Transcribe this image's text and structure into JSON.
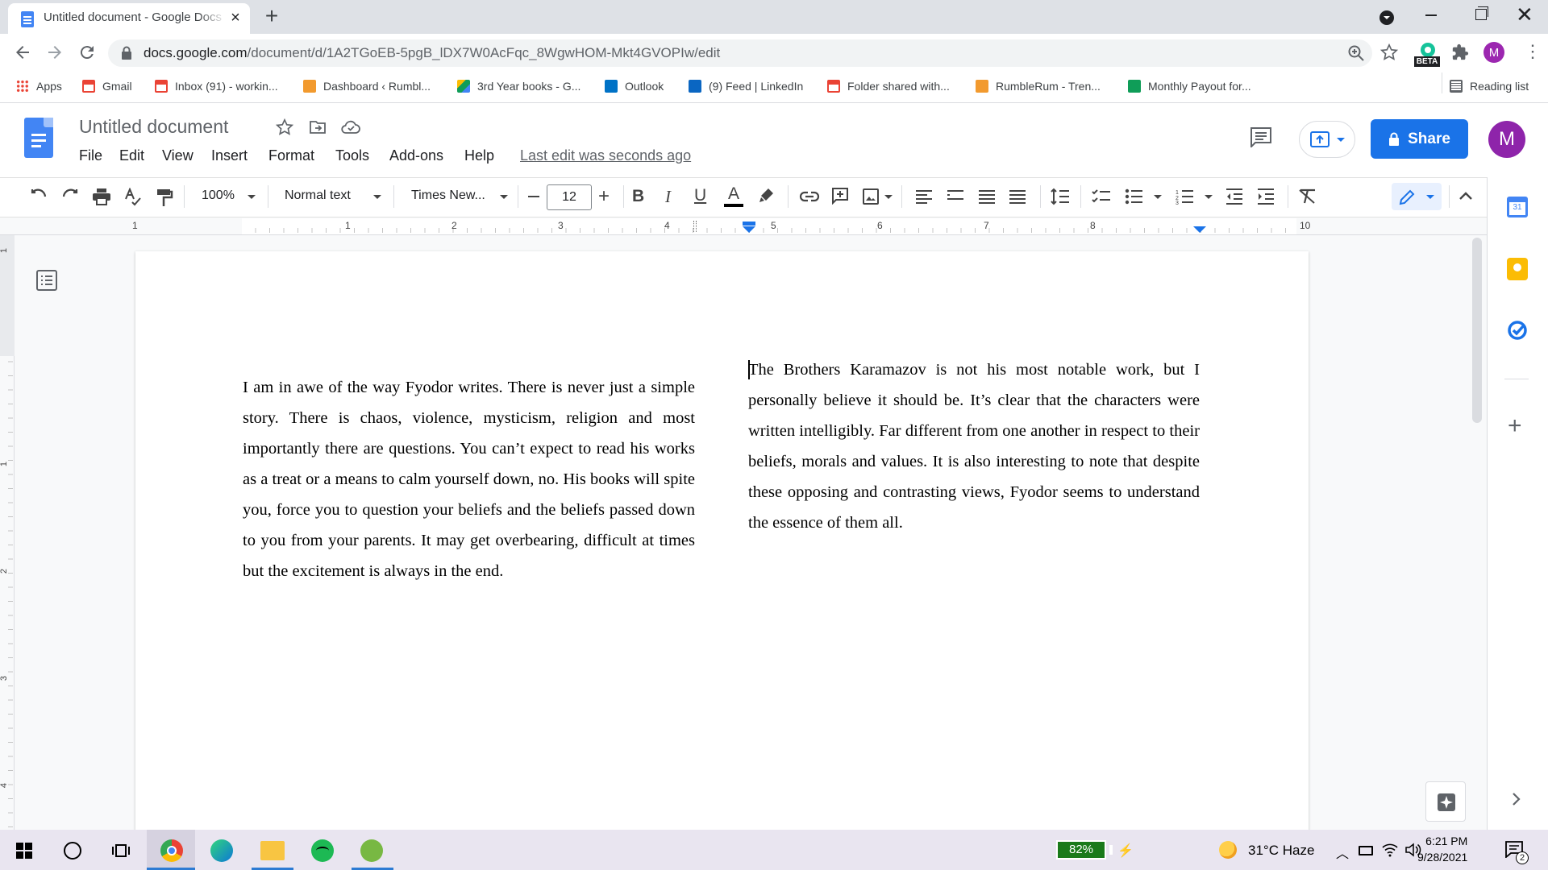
{
  "browser": {
    "tab_title": "Untitled document - Google Docs",
    "url_host": "docs.google.com",
    "url_path": "/document/d/1A2TGoEB-5pgB_lDX7W0AcFqc_8WgwHOM-Mkt4GVOPIw/edit",
    "profile_initial": "M",
    "extension_badge": "BETA",
    "reading_list": "Reading list",
    "bookmarks": [
      {
        "label": "Apps",
        "icon": "apps-grid-icon",
        "color": "#4285f4"
      },
      {
        "label": "Gmail",
        "icon": "gmail-icon",
        "color": "#ea4335"
      },
      {
        "label": "Inbox (91) - workin...",
        "icon": "gmail-icon",
        "color": "#ea4335"
      },
      {
        "label": "Dashboard ‹ Rumbl...",
        "icon": "rumblerum-icon",
        "color": "#f29a2e"
      },
      {
        "label": "3rd Year books - G...",
        "icon": "google-drive-icon",
        "color": "#0f9d58"
      },
      {
        "label": "Outlook",
        "icon": "outlook-icon",
        "color": "#0072c6"
      },
      {
        "label": "(9) Feed | LinkedIn",
        "icon": "linkedin-icon",
        "color": "#0a66c2"
      },
      {
        "label": "Folder shared with...",
        "icon": "gmail-icon",
        "color": "#ea4335"
      },
      {
        "label": "RumbleRum - Tren...",
        "icon": "rumblerum-icon",
        "color": "#f29a2e"
      },
      {
        "label": "Monthly Payout for...",
        "icon": "google-sheets-icon",
        "color": "#0f9d58"
      }
    ]
  },
  "docs": {
    "title": "Untitled document",
    "menu": [
      "File",
      "Edit",
      "View",
      "Insert",
      "Format",
      "Tools",
      "Add-ons",
      "Help"
    ],
    "last_edit": "Last edit was seconds ago",
    "share_label": "Share",
    "user_initial": "M",
    "colors": {
      "accent": "#1a73e8",
      "docs_blue": "#4285f4",
      "avatar": "#8e24aa"
    }
  },
  "toolbar": {
    "zoom": "100%",
    "style": "Normal text",
    "font": "Times New...",
    "font_size": "12"
  },
  "ruler": {
    "labels": [
      "1",
      "1",
      "2",
      "3",
      "4",
      "5",
      "6",
      "7",
      "8",
      "10"
    ],
    "vertical_labels": [
      "1",
      "1",
      "2",
      "3",
      "4"
    ]
  },
  "document": {
    "left_column": "I am in awe of the way Fyodor writes. There is never just a simple story. There is chaos, violence, mysticism, religion and most importantly there are questions. You can’t expect to read his works as a treat or a means to calm yourself down, no. His books will spite you, force you to question your beliefs and the beliefs passed down to you from your parents. It may get overbearing, difficult at times but the excitement is always in the end.",
    "right_column": "The Brothers Karamazov is not his most notable work, but I personally believe it should be. It’s clear that the characters were written intelligibly. Far different from one another in respect to their beliefs, morals and values. It is also interesting to note that despite these opposing and contrasting views, Fyodor seems to understand the essence of them all."
  },
  "taskbar": {
    "battery": "82%",
    "weather": "31°C  Haze",
    "time": "6:21 PM",
    "date": "9/28/2021",
    "notifications": "2"
  }
}
